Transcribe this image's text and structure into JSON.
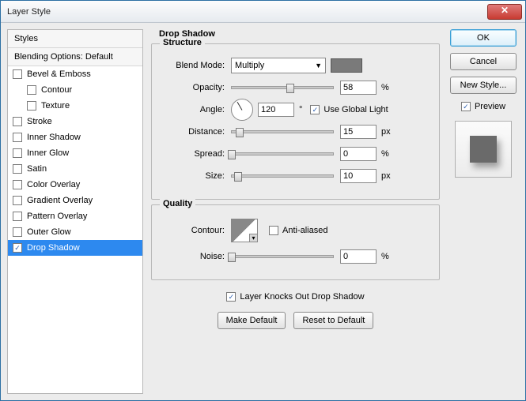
{
  "window": {
    "title": "Layer Style"
  },
  "sidebar": {
    "header": "Styles",
    "blending": "Blending Options: Default",
    "items": [
      {
        "label": "Bevel & Emboss",
        "checked": false,
        "indent": false
      },
      {
        "label": "Contour",
        "checked": false,
        "indent": true
      },
      {
        "label": "Texture",
        "checked": false,
        "indent": true
      },
      {
        "label": "Stroke",
        "checked": false,
        "indent": false
      },
      {
        "label": "Inner Shadow",
        "checked": false,
        "indent": false
      },
      {
        "label": "Inner Glow",
        "checked": false,
        "indent": false
      },
      {
        "label": "Satin",
        "checked": false,
        "indent": false
      },
      {
        "label": "Color Overlay",
        "checked": false,
        "indent": false
      },
      {
        "label": "Gradient Overlay",
        "checked": false,
        "indent": false
      },
      {
        "label": "Pattern Overlay",
        "checked": false,
        "indent": false
      },
      {
        "label": "Outer Glow",
        "checked": false,
        "indent": false
      },
      {
        "label": "Drop Shadow",
        "checked": true,
        "indent": false,
        "selected": true
      }
    ]
  },
  "panel": {
    "title": "Drop Shadow",
    "structure": {
      "legend": "Structure",
      "blend_mode_label": "Blend Mode:",
      "blend_mode_value": "Multiply",
      "shadow_color": "#7a7a7a",
      "opacity_label": "Opacity:",
      "opacity_value": "58",
      "opacity_pct": 58,
      "angle_label": "Angle:",
      "angle_value": "120",
      "angle_unit": "°",
      "global_light_label": "Use Global Light",
      "global_light_checked": true,
      "distance_label": "Distance:",
      "distance_value": "15",
      "distance_pct": 8,
      "spread_label": "Spread:",
      "spread_value": "0",
      "spread_pct": 0,
      "size_label": "Size:",
      "size_value": "10",
      "size_pct": 6,
      "unit_pct": "%",
      "unit_px": "px"
    },
    "quality": {
      "legend": "Quality",
      "contour_label": "Contour:",
      "antialias_label": "Anti-aliased",
      "antialias_checked": false,
      "noise_label": "Noise:",
      "noise_value": "0",
      "noise_pct": 0
    },
    "knockout_label": "Layer Knocks Out Drop Shadow",
    "knockout_checked": true,
    "make_default": "Make Default",
    "reset_default": "Reset to Default"
  },
  "buttons": {
    "ok": "OK",
    "cancel": "Cancel",
    "newstyle": "New Style...",
    "preview_label": "Preview",
    "preview_checked": true
  }
}
